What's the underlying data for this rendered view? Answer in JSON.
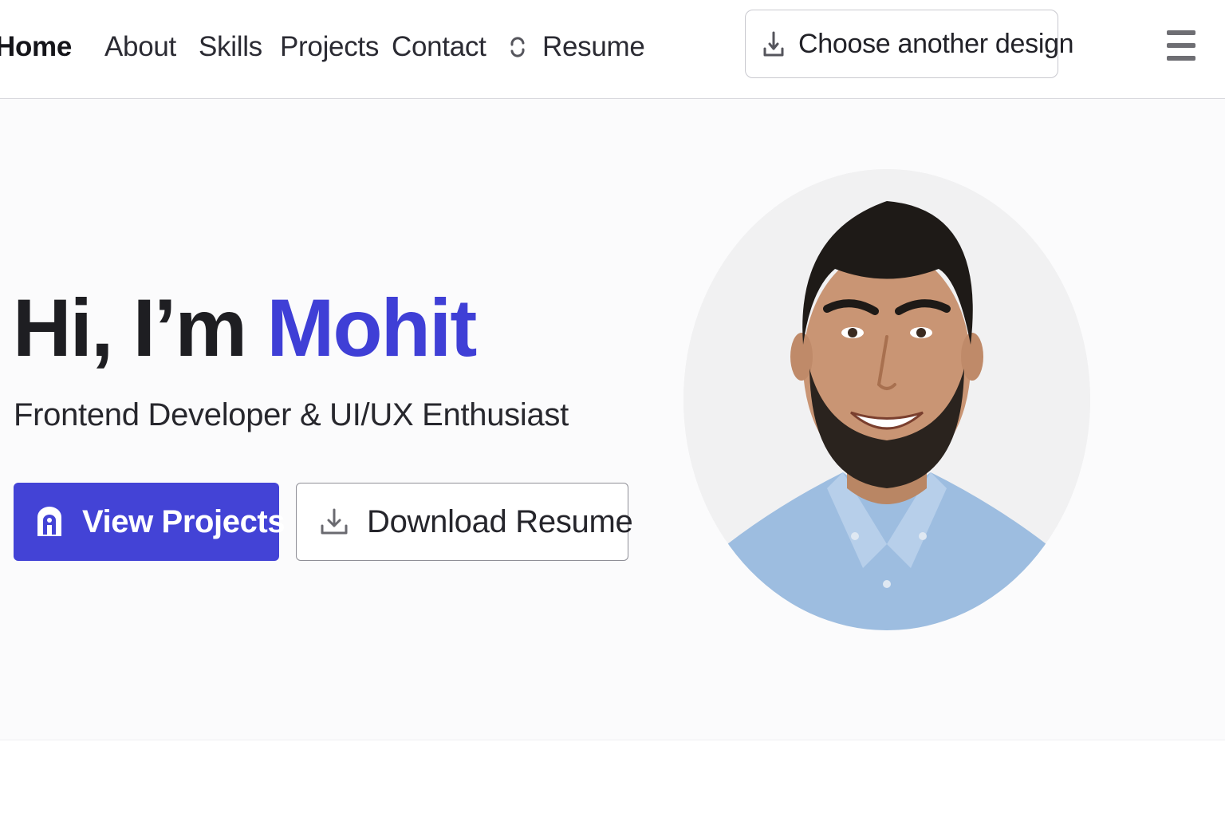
{
  "nav": {
    "links": [
      "Home",
      "About",
      "Skills",
      "Projects",
      "Contact"
    ],
    "resume_label": "Resume",
    "design_button_label": "Choose another design"
  },
  "hero": {
    "greeting": "Hi, I’m",
    "name": "Mohit",
    "subtitle": "Frontend Developer & UI/UX Enthusiast",
    "primary_button_label": "View Projects",
    "secondary_button_label": "Download Resume",
    "accent_color": "#4343d6"
  },
  "icons": {
    "resume": "refresh-icon",
    "design": "download-line-icon",
    "menu": "hamburger-menu-icon",
    "view_projects": "portfolio-icon",
    "download": "download-tray-icon"
  }
}
